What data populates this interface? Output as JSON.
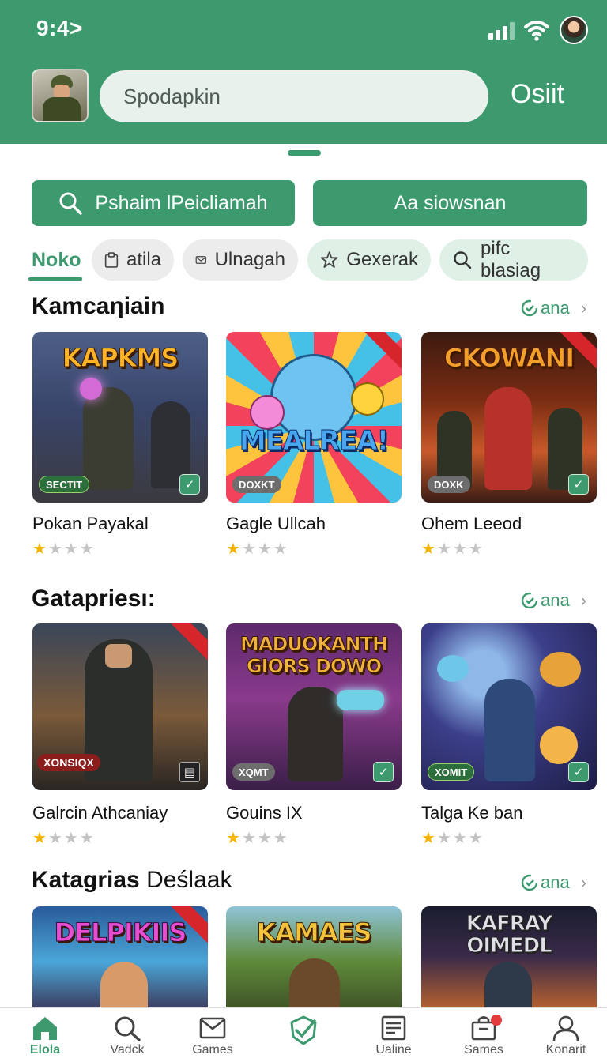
{
  "status_bar": {
    "time": "9:4>"
  },
  "header": {
    "search_text": "Spodapkin",
    "action_label": "Osiit"
  },
  "buttons": {
    "primary_label": "Pshaim lPeicliamah",
    "secondary_label": "Aa siowsnan"
  },
  "chips": {
    "active": "Noko",
    "items": [
      "atila",
      "Ulnagah",
      "Gexerak",
      "pifc blasiag"
    ]
  },
  "sections": [
    {
      "title": "Kamcaηiain",
      "more": "ana",
      "cards": [
        {
          "thumb_title": "KAPKMS",
          "badge": "SECTIT",
          "name": "Pokan Payakal",
          "rating": 1
        },
        {
          "thumb_title": "MEALREA!",
          "badge": "DOXKT",
          "name": "Gagle Ullcah",
          "rating": 1
        },
        {
          "thumb_title": "CKOWANI",
          "badge": "DOXK",
          "name": "Ohem Leeod",
          "rating": 1
        }
      ]
    },
    {
      "title": "Gatapriesı:",
      "more": "ana",
      "cards": [
        {
          "thumb_title": "",
          "badge": "XONSIQX",
          "name": "Galrcin Athcaniay",
          "rating": 1
        },
        {
          "thumb_title": "MADUOKANTH GIORS DOWO",
          "badge": "XQMT",
          "name": "Gouins IX",
          "rating": 1
        },
        {
          "thumb_title": "",
          "badge": "XOMIT",
          "name": "Talga Ke ban",
          "rating": 1
        }
      ]
    },
    {
      "title_bold": "Katagrias",
      "title_light": "Deślaak",
      "more": "ana",
      "cards": [
        {
          "thumb_title": "DELPIKIIS"
        },
        {
          "thumb_title": "KAMAES"
        },
        {
          "thumb_title": "KAFRAY OIMEDL"
        }
      ]
    }
  ],
  "bottom_nav": [
    {
      "label": "Elola",
      "icon": "home-icon"
    },
    {
      "label": "Vadck",
      "icon": "search-icon"
    },
    {
      "label": "Games",
      "icon": "mail-icon"
    },
    {
      "label": "",
      "icon": "check-badge-icon"
    },
    {
      "label": "Ualine",
      "icon": "document-icon"
    },
    {
      "label": "Sames",
      "icon": "bag-icon"
    },
    {
      "label": "Konarit",
      "icon": "profile-icon"
    }
  ],
  "colors": {
    "brand": "#3d9a6f",
    "star": "#f4b400",
    "badge_red": "#e23c3c"
  }
}
